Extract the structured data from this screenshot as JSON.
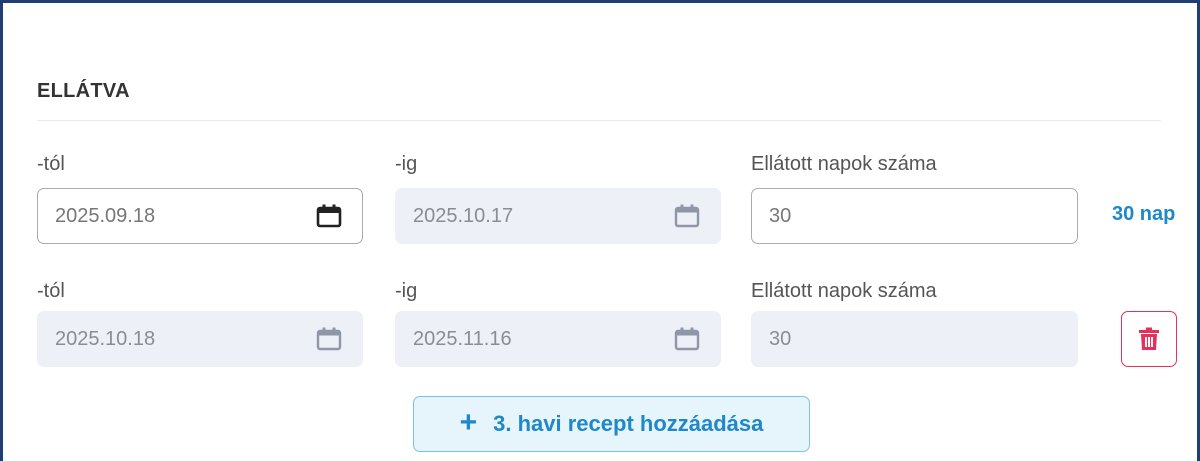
{
  "section": {
    "title": "ELLÁTVA"
  },
  "rows": [
    {
      "from_label": "-tól",
      "from_value": "2025.09.18",
      "to_label": "-ig",
      "to_value": "2025.10.17",
      "days_label": "Ellátott napok száma",
      "days_value": "30",
      "days_note": "30 nap"
    },
    {
      "from_label": "-tól",
      "from_value": "2025.10.18",
      "to_label": "-ig",
      "to_value": "2025.11.16",
      "days_label": "Ellátott napok száma",
      "days_value": "30"
    }
  ],
  "add_button": {
    "label": "3. havi recept hozzáadása",
    "icon": "plus-icon"
  },
  "colors": {
    "accent": "#1e88c8",
    "danger": "#e62f5a",
    "frame": "#1f3f73",
    "disabled_bg": "#edf0f7"
  }
}
